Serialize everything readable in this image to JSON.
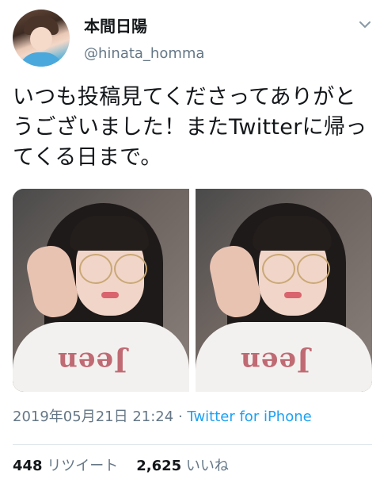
{
  "user": {
    "display_name": "本間日陽",
    "handle": "@hinata_homma"
  },
  "tweet": {
    "text": "いつも投稿見てくださってありがとうございました！またTwitterに帰ってくる日まで。",
    "timestamp": "2019年05月21日 21:24",
    "separator": "·",
    "source": "Twitter for iPhone",
    "photos": [
      {
        "shirt_print": "Jeen"
      },
      {
        "shirt_print": "Jeen"
      }
    ]
  },
  "stats": {
    "retweets_count": "448",
    "retweets_label": "リツイート",
    "likes_count": "2,625",
    "likes_label": "いいね"
  },
  "colors": {
    "text": "#14171a",
    "secondary": "#657786",
    "link": "#1da1f2",
    "divider": "#e1e8ed"
  },
  "icons": {
    "menu": "chevron-down-icon"
  }
}
